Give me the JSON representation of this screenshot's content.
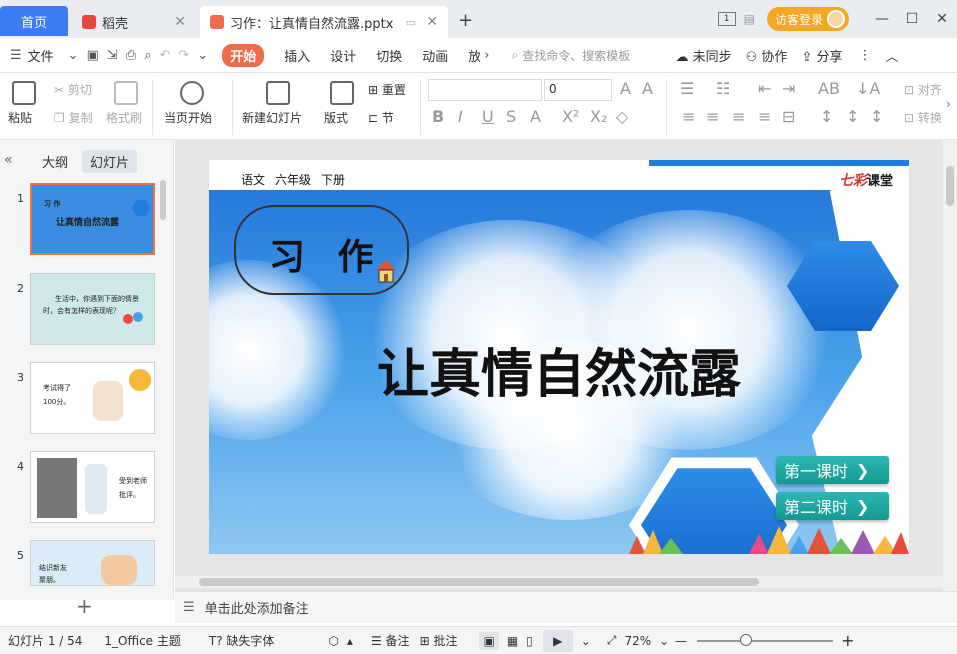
{
  "tabbar": {
    "home_tab": "首页",
    "tabs": [
      {
        "label": "稻壳"
      },
      {
        "label": "习作：让真情自然流露.pptx"
      }
    ],
    "new_tab_symbol": "+",
    "window_count": "1",
    "login_label": "访客登录"
  },
  "menubar": {
    "file_label": "文件",
    "items": [
      "开始",
      "插入",
      "设计",
      "切换",
      "动画",
      "放"
    ],
    "search_placeholder": "查找命令、搜索模板",
    "sync_label": "未同步",
    "collab_label": "协作",
    "share_label": "分享"
  },
  "ribbon": {
    "paste": "粘贴",
    "cut": "剪切",
    "copy": "复制",
    "format_brush": "格式刷",
    "play_from_current": "当页开始",
    "new_slide": "新建幻灯片",
    "layout": "版式",
    "reset": "重置",
    "section": "节",
    "font_size_value": "0",
    "align_right_label": "对齐",
    "convert_label": "转换"
  },
  "left_pane": {
    "tabs": [
      "大纲",
      "幻灯片"
    ],
    "selected_tab": "幻灯片",
    "thumbs": [
      {
        "num": "1",
        "lines": [
          "习 作",
          "让真情自然流露"
        ]
      },
      {
        "num": "2",
        "lines": [
          "生活中，你遇到下面的情景",
          "时，会有怎样的表现呢？"
        ]
      },
      {
        "num": "3",
        "lines": [
          "考试得了",
          "100分。"
        ]
      },
      {
        "num": "4",
        "lines": [
          "受到老师",
          "批评。"
        ]
      },
      {
        "num": "5",
        "lines": [
          "结识新友",
          "聚朋。"
        ]
      }
    ]
  },
  "slide": {
    "header_items": [
      "语文",
      "六年级",
      "下册"
    ],
    "logo_a": "七彩",
    "logo_b": "课堂",
    "subtitle": "习 作",
    "title": "让真情自然流露",
    "buttons": [
      "第一课时",
      "第二课时"
    ],
    "button_arrow": "❯"
  },
  "notes": {
    "placeholder": "单击此处添加备注"
  },
  "status": {
    "slide_indicator": "幻灯片 1 / 54",
    "theme": "1_Office 主题",
    "missing_font": "缺失字体",
    "notes_label": "备注",
    "comment_label": "批注",
    "zoom": "72%",
    "zoom_level": 0.36
  },
  "colors": {
    "accent": "#3b7cf6",
    "start_tab": "#ef6b4b",
    "slide_sky": "#3a8de0",
    "teal_button": "#1aa9a3",
    "hex_blue": "#1e7ee0"
  }
}
